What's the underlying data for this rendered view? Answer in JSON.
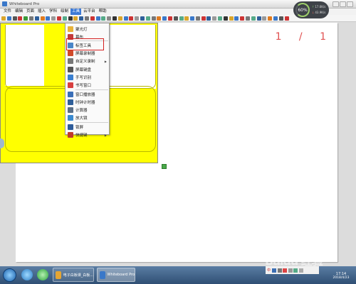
{
  "window": {
    "title": "Whiteboard Pro"
  },
  "menu": {
    "items": [
      {
        "label": "文件",
        "active": false
      },
      {
        "label": "编辑",
        "active": false
      },
      {
        "label": "页面",
        "active": false
      },
      {
        "label": "插入",
        "active": false
      },
      {
        "label": "学科",
        "active": false
      },
      {
        "label": "绘制",
        "active": false
      },
      {
        "label": "工具",
        "active": true
      },
      {
        "label": "云平台",
        "active": false
      },
      {
        "label": "帮助",
        "active": false
      }
    ]
  },
  "status_widget": {
    "percent": "60%",
    "up": "17.6K/s",
    "down": "43.9K/s"
  },
  "canvas": {
    "page_counter": "1 / 1"
  },
  "tools_menu": {
    "items": [
      {
        "label": "聚光灯",
        "icon": "spotlight-icon",
        "color": "#e8b33a",
        "submenu": false
      },
      {
        "label": "幕布",
        "icon": "curtain-icon",
        "color": "#c23b3b",
        "submenu": false
      },
      {
        "label": "标签工具",
        "icon": "label-tool-icon",
        "color": "#4a86c8",
        "submenu": false
      },
      {
        "label": "屏幕录制器",
        "icon": "screen-recorder-icon",
        "color": "#d04a2a",
        "submenu": false
      },
      {
        "label": "自定义录制",
        "icon": "custom-record-icon",
        "color": "#777777",
        "submenu": true
      },
      {
        "label": "屏幕键盘",
        "icon": "keyboard-icon",
        "color": "#555555",
        "submenu": false
      },
      {
        "label": "手写识别",
        "icon": "handwriting-icon",
        "color": "#3a7fd0",
        "submenu": false
      },
      {
        "label": "书写窗口",
        "icon": "writing-window-icon",
        "color": "#d84040",
        "submenu": false
      },
      {
        "label": "窗口播放器",
        "icon": "window-player-icon",
        "color": "#3a6fb8",
        "submenu": false
      },
      {
        "label": "时钟计时器",
        "icon": "clock-timer-icon",
        "color": "#2f5f9a",
        "submenu": false
      },
      {
        "label": "计算器",
        "icon": "calculator-icon",
        "color": "#5b6f86",
        "submenu": false
      },
      {
        "label": "放大镜",
        "icon": "magnifier-icon",
        "color": "#3a8ad0",
        "submenu": false
      },
      {
        "label": "锁屏",
        "icon": "lock-screen-icon",
        "color": "#2e5c9a",
        "submenu": false
      },
      {
        "label": "快捷键",
        "icon": "shortcut-icon",
        "color": "#c0392b",
        "submenu": true
      }
    ]
  },
  "taskbar": {
    "tasks": [
      {
        "label": "电子白板课_白板...",
        "active": false
      },
      {
        "label": "Whiteboard Pro",
        "active": true
      }
    ],
    "tray_lang": "中",
    "clock_time": "17:14",
    "clock_date": "2018/4/23"
  },
  "watermark": "Baidu 经验"
}
